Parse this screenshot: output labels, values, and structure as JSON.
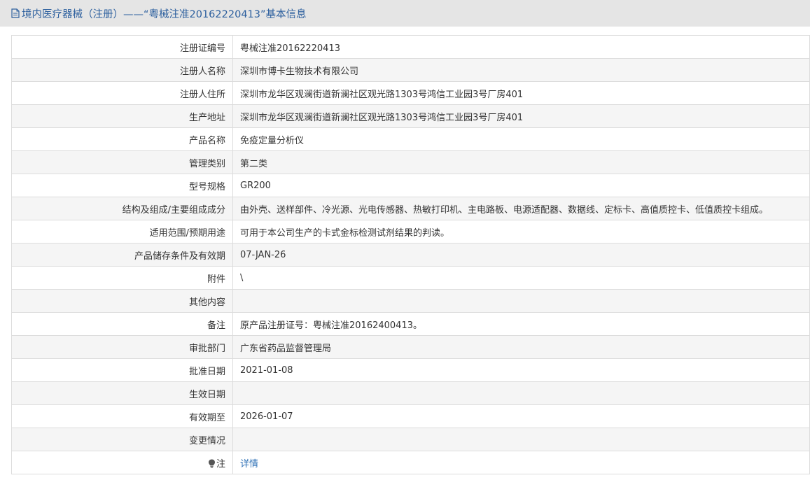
{
  "header": {
    "title": "境内医疗器械（注册）——“粤械注准20162220413”基本信息",
    "icon": "document-icon",
    "color": "#2c5f9e"
  },
  "rows": [
    {
      "label": "注册证编号",
      "value": "粤械注准20162220413"
    },
    {
      "label": "注册人名称",
      "value": "深圳市博卡生物技术有限公司"
    },
    {
      "label": "注册人住所",
      "value": "深圳市龙华区观澜街道新澜社区观光路1303号鸿信工业园3号厂房401"
    },
    {
      "label": "生产地址",
      "value": "深圳市龙华区观澜街道新澜社区观光路1303号鸿信工业园3号厂房401"
    },
    {
      "label": "产品名称",
      "value": "免疫定量分析仪"
    },
    {
      "label": "管理类别",
      "value": "第二类"
    },
    {
      "label": "型号规格",
      "value": "GR200"
    },
    {
      "label": "结构及组成/主要组成成分",
      "value": "由外壳、送样部件、冷光源、光电传感器、热敏打印机、主电路板、电源适配器、数据线、定标卡、高值质控卡、低值质控卡组成。"
    },
    {
      "label": "适用范围/预期用途",
      "value": "可用于本公司生产的卡式金标检测试剂结果的判读。"
    },
    {
      "label": "产品储存条件及有效期",
      "value": "07-JAN-26"
    },
    {
      "label": "附件",
      "value": "\\"
    },
    {
      "label": "其他内容",
      "value": ""
    },
    {
      "label": "备注",
      "value": "原产品注册证号：粤械注准20162400413。"
    },
    {
      "label": "审批部门",
      "value": "广东省药品监督管理局"
    },
    {
      "label": "批准日期",
      "value": "2021-01-08"
    },
    {
      "label": "生效日期",
      "value": ""
    },
    {
      "label": "有效期至",
      "value": "2026-01-07"
    },
    {
      "label": "变更情况",
      "value": ""
    }
  ],
  "note": {
    "label": "注",
    "icon": "lightbulb-icon",
    "link_text": "详情",
    "link_color": "#2c6fb5"
  }
}
